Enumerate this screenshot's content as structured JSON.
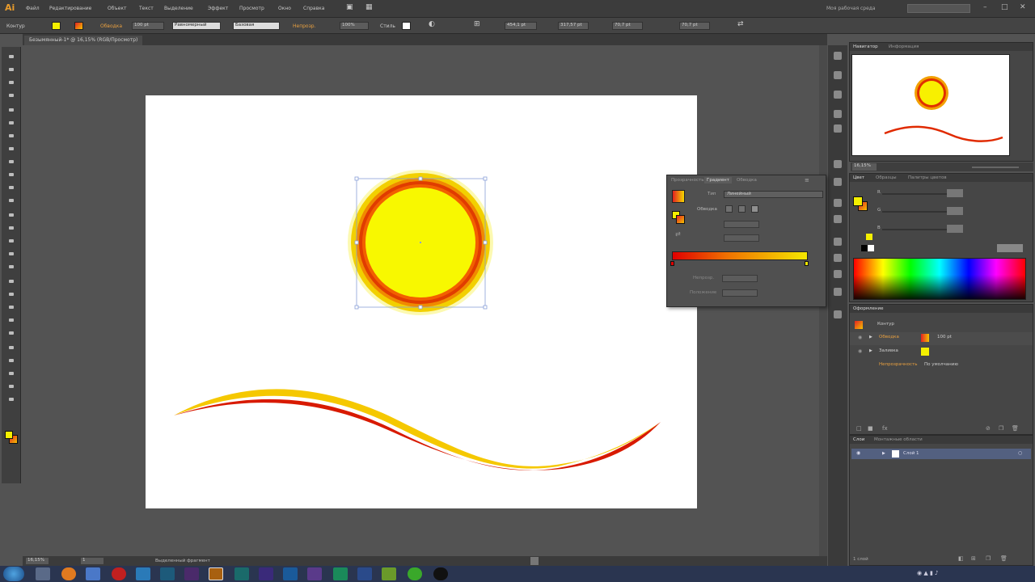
{
  "app": {
    "logo": "Ai"
  },
  "menubar": {
    "items": [
      "Файл",
      "Редактирование",
      "Объект",
      "Текст",
      "Выделение",
      "Эффект",
      "Просмотр",
      "Окно",
      "Справка"
    ],
    "workspace": "Моя рабочая среда"
  },
  "control_bar": {
    "object_label": "Контур",
    "stroke_label": "Обводка",
    "stroke_weight": "100 pt",
    "profile": "Равномерный",
    "brush": "Базовая",
    "opacity_label": "Непрозр.",
    "opacity_value": "100%",
    "style_label": "Стиль",
    "x_value": "454,1 pt",
    "y_value": "317,57 pt",
    "w_value": "70,7 pt",
    "h_value": "70,7 pt"
  },
  "document": {
    "tab_title": "Безымянный-1* @ 16,15% (RGB/Просмотр)"
  },
  "gradient_panel": {
    "tabs": [
      "Прозрачность",
      "Градиент",
      "Обводка"
    ],
    "type_label": "Тип",
    "type_value": "Линейный",
    "stroke_label": "Обводка",
    "opacity_label": "Непрозр.",
    "location_label": "Положение"
  },
  "navigator": {
    "tabs": [
      "Навигатор",
      "Информация"
    ],
    "zoom": "16,15%"
  },
  "color_panel": {
    "tabs": [
      "Цвет",
      "Образцы",
      "Палитры цветов"
    ],
    "channels": [
      "R",
      "G",
      "B"
    ]
  },
  "appearance": {
    "title": "Оформление",
    "object": "Контур",
    "stroke_label": "Обводка",
    "stroke_weight": "100 pt",
    "fill_label": "Заливка",
    "opacity_label": "Непрозрачность",
    "opacity_value": "По умолчанию"
  },
  "layers": {
    "tabs": [
      "Слои",
      "Монтажные области"
    ],
    "layer_name": "Слой 1",
    "footer": "1 слой"
  },
  "statusbar": {
    "zoom": "16,15%",
    "page": "1",
    "tool": "Выделенный фрагмент"
  },
  "colors": {
    "sun_fill": "#f8f800",
    "ring_inner": "#e02a00",
    "ring_outer": "#f0c800",
    "wave_dark": "#d41800",
    "wave_light": "#f5c800"
  }
}
